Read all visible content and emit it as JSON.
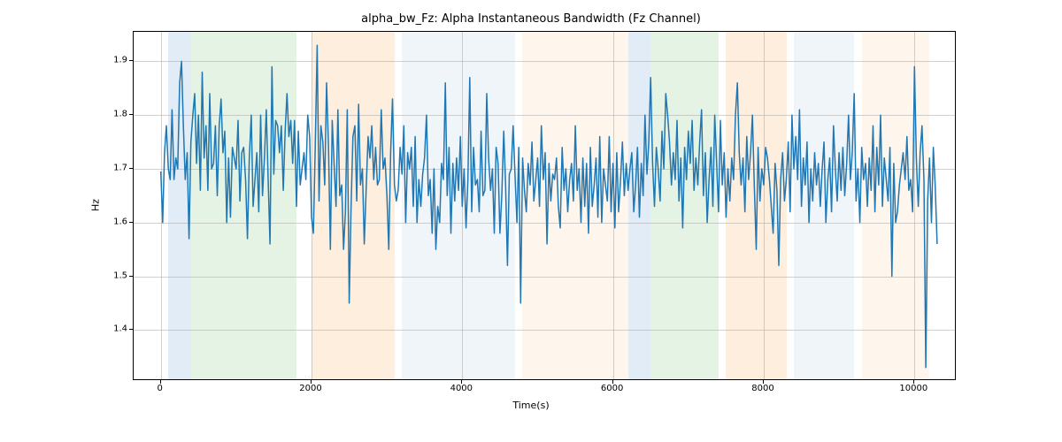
{
  "chart_data": {
    "type": "line",
    "title": "alpha_bw_Fz: Alpha Instantaneous Bandwidth (Fz Channel)",
    "xlabel": "Time(s)",
    "ylabel": "Hz",
    "xlim": [
      -360,
      10560
    ],
    "ylim": [
      1.305,
      1.955
    ],
    "xticks": [
      0,
      2000,
      4000,
      6000,
      8000,
      10000
    ],
    "yticks": [
      1.4,
      1.5,
      1.6,
      1.7,
      1.8,
      1.9
    ],
    "line_color": "#1f77b4",
    "bands": [
      {
        "start": 100,
        "end": 400,
        "color": "#9ac1e0"
      },
      {
        "start": 400,
        "end": 1800,
        "color": "#a8d8a8"
      },
      {
        "start": 2000,
        "end": 3100,
        "color": "#f8c690"
      },
      {
        "start": 3200,
        "end": 4700,
        "color": "#cddff0"
      },
      {
        "start": 4800,
        "end": 6200,
        "color": "#fde1c2"
      },
      {
        "start": 6200,
        "end": 6500,
        "color": "#9ac1e0"
      },
      {
        "start": 6500,
        "end": 7400,
        "color": "#a8d8a8"
      },
      {
        "start": 7500,
        "end": 8300,
        "color": "#f8c690"
      },
      {
        "start": 8400,
        "end": 9200,
        "color": "#cddff0"
      },
      {
        "start": 9300,
        "end": 10200,
        "color": "#fde1c2"
      }
    ],
    "series": [
      {
        "name": "alpha_bw_Fz",
        "x_step": 25,
        "x_start": 0,
        "values": [
          1.695,
          1.6,
          1.73,
          1.78,
          1.7,
          1.68,
          1.81,
          1.68,
          1.72,
          1.7,
          1.86,
          1.9,
          1.78,
          1.68,
          1.73,
          1.57,
          1.75,
          1.8,
          1.84,
          1.71,
          1.8,
          1.66,
          1.88,
          1.72,
          1.78,
          1.66,
          1.84,
          1.7,
          1.71,
          1.78,
          1.65,
          1.78,
          1.83,
          1.73,
          1.77,
          1.6,
          1.72,
          1.61,
          1.74,
          1.72,
          1.7,
          1.79,
          1.64,
          1.73,
          1.74,
          1.68,
          1.57,
          1.72,
          1.8,
          1.63,
          1.68,
          1.73,
          1.62,
          1.8,
          1.65,
          1.72,
          1.81,
          1.68,
          1.56,
          1.89,
          1.69,
          1.79,
          1.78,
          1.73,
          1.78,
          1.66,
          1.77,
          1.84,
          1.76,
          1.79,
          1.71,
          1.79,
          1.63,
          1.77,
          1.67,
          1.7,
          1.73,
          1.68,
          1.8,
          1.76,
          1.61,
          1.58,
          1.74,
          1.93,
          1.64,
          1.78,
          1.75,
          1.67,
          1.86,
          1.74,
          1.55,
          1.79,
          1.71,
          1.63,
          1.81,
          1.65,
          1.67,
          1.55,
          1.62,
          1.81,
          1.45,
          1.63,
          1.76,
          1.78,
          1.64,
          1.82,
          1.67,
          1.7,
          1.56,
          1.66,
          1.76,
          1.72,
          1.78,
          1.68,
          1.74,
          1.67,
          1.68,
          1.81,
          1.7,
          1.72,
          1.65,
          1.55,
          1.73,
          1.83,
          1.67,
          1.64,
          1.66,
          1.74,
          1.69,
          1.78,
          1.6,
          1.73,
          1.7,
          1.74,
          1.63,
          1.76,
          1.6,
          1.68,
          1.63,
          1.69,
          1.72,
          1.8,
          1.65,
          1.68,
          1.58,
          1.7,
          1.55,
          1.63,
          1.6,
          1.71,
          1.68,
          1.86,
          1.65,
          1.74,
          1.58,
          1.71,
          1.64,
          1.72,
          1.66,
          1.76,
          1.63,
          1.7,
          1.59,
          1.68,
          1.87,
          1.62,
          1.74,
          1.67,
          1.68,
          1.62,
          1.77,
          1.65,
          1.66,
          1.84,
          1.72,
          1.66,
          1.7,
          1.58,
          1.74,
          1.71,
          1.58,
          1.65,
          1.77,
          1.67,
          1.52,
          1.69,
          1.7,
          1.78,
          1.69,
          1.6,
          1.74,
          1.45,
          1.72,
          1.66,
          1.62,
          1.71,
          1.67,
          1.75,
          1.64,
          1.68,
          1.72,
          1.63,
          1.78,
          1.68,
          1.73,
          1.56,
          1.71,
          1.64,
          1.69,
          1.68,
          1.72,
          1.63,
          1.59,
          1.74,
          1.66,
          1.7,
          1.62,
          1.68,
          1.71,
          1.64,
          1.78,
          1.66,
          1.7,
          1.6,
          1.72,
          1.63,
          1.71,
          1.58,
          1.74,
          1.63,
          1.67,
          1.72,
          1.61,
          1.76,
          1.6,
          1.7,
          1.67,
          1.64,
          1.76,
          1.62,
          1.71,
          1.59,
          1.73,
          1.62,
          1.68,
          1.75,
          1.65,
          1.71,
          1.66,
          1.7,
          1.73,
          1.62,
          1.67,
          1.74,
          1.61,
          1.71,
          1.65,
          1.8,
          1.69,
          1.75,
          1.87,
          1.71,
          1.63,
          1.74,
          1.7,
          1.64,
          1.77,
          1.7,
          1.84,
          1.8,
          1.75,
          1.67,
          1.73,
          1.68,
          1.79,
          1.64,
          1.72,
          1.59,
          1.74,
          1.68,
          1.77,
          1.71,
          1.79,
          1.66,
          1.72,
          1.67,
          1.75,
          1.81,
          1.65,
          1.73,
          1.6,
          1.68,
          1.74,
          1.63,
          1.8,
          1.71,
          1.62,
          1.79,
          1.67,
          1.73,
          1.61,
          1.7,
          1.64,
          1.72,
          1.68,
          1.8,
          1.86,
          1.73,
          1.67,
          1.72,
          1.62,
          1.76,
          1.68,
          1.73,
          1.8,
          1.67,
          1.55,
          1.74,
          1.64,
          1.7,
          1.67,
          1.74,
          1.72,
          1.68,
          1.63,
          1.58,
          1.71,
          1.66,
          1.52,
          1.68,
          1.73,
          1.64,
          1.68,
          1.75,
          1.62,
          1.8,
          1.7,
          1.76,
          1.68,
          1.81,
          1.63,
          1.72,
          1.67,
          1.75,
          1.6,
          1.7,
          1.64,
          1.73,
          1.67,
          1.71,
          1.63,
          1.7,
          1.75,
          1.6,
          1.68,
          1.72,
          1.62,
          1.78,
          1.7,
          1.64,
          1.73,
          1.66,
          1.74,
          1.65,
          1.71,
          1.8,
          1.68,
          1.73,
          1.84,
          1.64,
          1.7,
          1.6,
          1.74,
          1.68,
          1.71,
          1.63,
          1.72,
          1.66,
          1.78,
          1.62,
          1.74,
          1.67,
          1.8,
          1.63,
          1.72,
          1.68,
          1.64,
          1.74,
          1.5,
          1.71,
          1.6,
          1.62,
          1.67,
          1.7,
          1.73,
          1.68,
          1.76,
          1.66,
          1.68,
          1.62,
          1.89,
          1.72,
          1.63,
          1.73,
          1.78,
          1.68,
          1.33,
          1.64,
          1.72,
          1.6,
          1.74,
          1.67,
          1.56
        ]
      }
    ]
  }
}
